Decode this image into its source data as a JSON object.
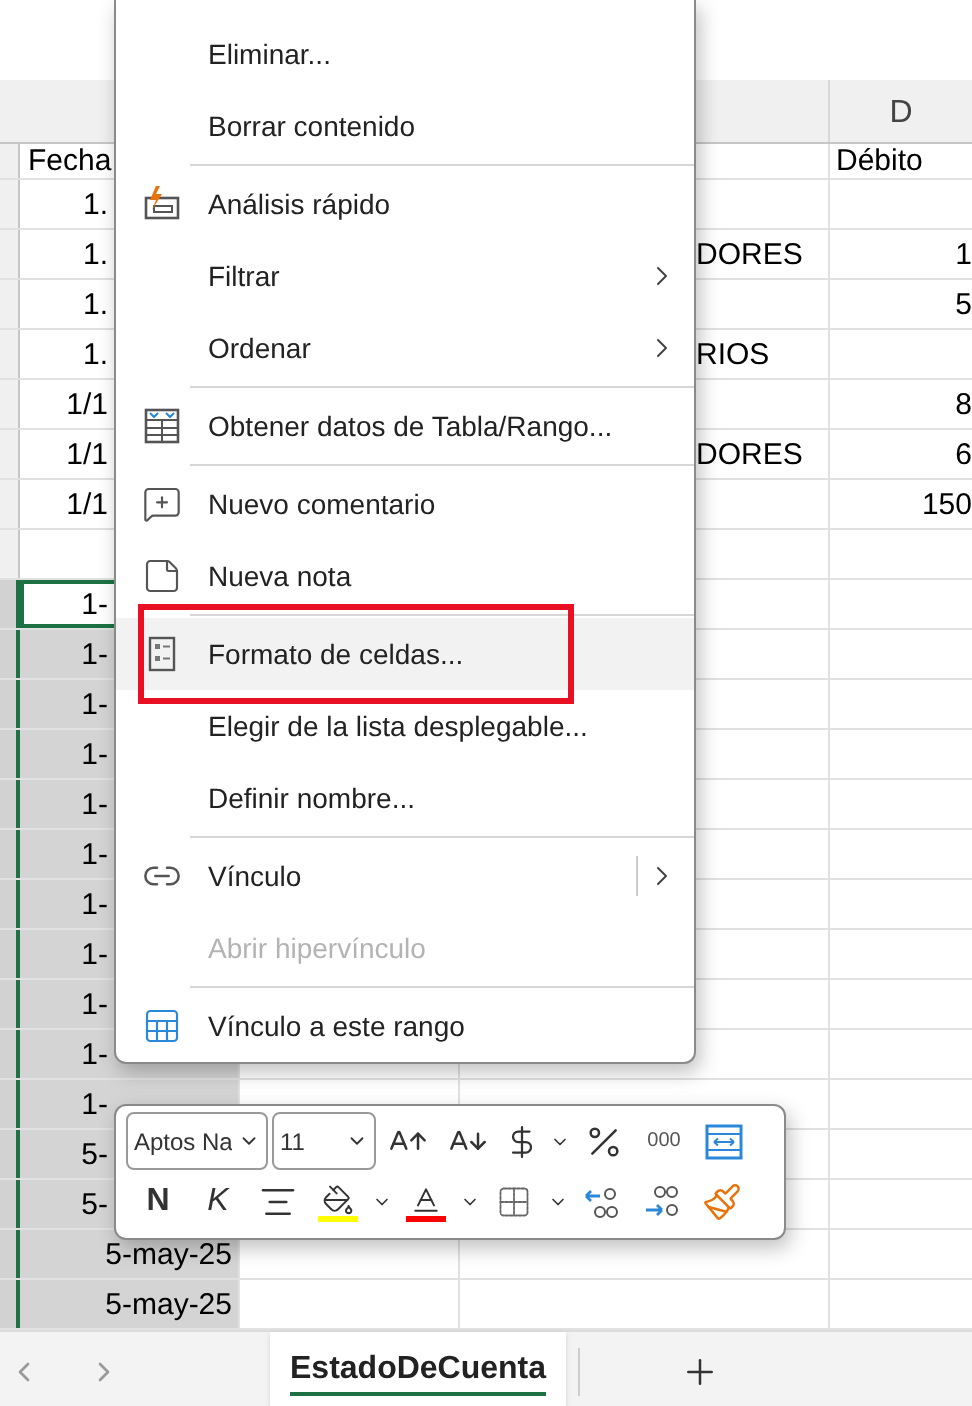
{
  "sheet": {
    "column_header": "D",
    "rows": [
      {
        "col_a": "Fecha",
        "col_c": "",
        "col_d": "Débito",
        "selected": false,
        "active": false
      },
      {
        "col_a": "1.",
        "col_c": "",
        "col_d": "",
        "selected": false,
        "active": false
      },
      {
        "col_a": "1.",
        "col_c": "DORES",
        "col_d": "1",
        "selected": false,
        "active": false
      },
      {
        "col_a": "1.",
        "col_c": "",
        "col_d": "5",
        "selected": false,
        "active": false
      },
      {
        "col_a": "1.",
        "col_c": "RIOS",
        "col_d": "",
        "selected": false,
        "active": false
      },
      {
        "col_a": "1/1",
        "col_c": "",
        "col_d": "8",
        "selected": false,
        "active": false
      },
      {
        "col_a": "1/1",
        "col_c": "DORES",
        "col_d": "6",
        "selected": false,
        "active": false
      },
      {
        "col_a": "1/1",
        "col_c": "",
        "col_d": "150",
        "selected": false,
        "active": false
      },
      {
        "col_a": "",
        "col_c": "",
        "col_d": "",
        "selected": false,
        "active": false
      },
      {
        "col_a": "1-",
        "col_c": "",
        "col_d": "",
        "selected": true,
        "active": true
      },
      {
        "col_a": "1-",
        "col_c": "",
        "col_d": "",
        "selected": true,
        "active": false
      },
      {
        "col_a": "1-",
        "col_c": "",
        "col_d": "",
        "selected": true,
        "active": false
      },
      {
        "col_a": "1-",
        "col_c": "",
        "col_d": "",
        "selected": true,
        "active": false
      },
      {
        "col_a": "1-",
        "col_c": "",
        "col_d": "",
        "selected": true,
        "active": false
      },
      {
        "col_a": "1-",
        "col_c": "",
        "col_d": "",
        "selected": true,
        "active": false
      },
      {
        "col_a": "1-",
        "col_c": "",
        "col_d": "",
        "selected": true,
        "active": false
      },
      {
        "col_a": "1-",
        "col_c": "",
        "col_d": "",
        "selected": true,
        "active": false
      },
      {
        "col_a": "1-",
        "col_c": "",
        "col_d": "",
        "selected": true,
        "active": false
      },
      {
        "col_a": "1-",
        "col_c": "",
        "col_d": "",
        "selected": true,
        "active": false
      },
      {
        "col_a": "1-",
        "col_c": "",
        "col_d": "",
        "selected": true,
        "active": false
      },
      {
        "col_a": "5-",
        "col_c": "",
        "col_d": "",
        "selected": true,
        "active": false
      },
      {
        "col_a": "5-",
        "col_c": "",
        "col_d": "",
        "selected": true,
        "active": false
      },
      {
        "col_a": "5-may-25",
        "col_c": "",
        "col_d": "",
        "selected": true,
        "active": false
      },
      {
        "col_a": "5-may-25",
        "col_c": "",
        "col_d": "",
        "selected": true,
        "active": false
      }
    ]
  },
  "context_menu": {
    "sections": [
      {
        "items": [
          {
            "label": "Eliminar...",
            "kind": "plain",
            "submenu": false,
            "split": false,
            "disabled": false,
            "hovered": false
          },
          {
            "label": "Borrar contenido",
            "kind": "plain",
            "submenu": false,
            "split": false,
            "disabled": false,
            "hovered": false
          }
        ]
      },
      {
        "items": [
          {
            "label": "Análisis rápido",
            "kind": "quick-analysis",
            "submenu": false,
            "split": false,
            "disabled": false,
            "hovered": false
          },
          {
            "label": "Filtrar",
            "kind": "plain",
            "submenu": true,
            "split": false,
            "disabled": false,
            "hovered": false
          },
          {
            "label": "Ordenar",
            "kind": "plain",
            "submenu": true,
            "split": false,
            "disabled": false,
            "hovered": false
          }
        ]
      },
      {
        "items": [
          {
            "label": "Obtener datos de Tabla/Rango...",
            "kind": "table-data",
            "submenu": false,
            "split": false,
            "disabled": false,
            "hovered": false
          }
        ]
      },
      {
        "items": [
          {
            "label": "Nuevo comentario",
            "kind": "comment",
            "submenu": false,
            "split": false,
            "disabled": false,
            "hovered": false
          },
          {
            "label": "Nueva nota",
            "kind": "note",
            "submenu": false,
            "split": false,
            "disabled": false,
            "hovered": false
          }
        ]
      },
      {
        "items": [
          {
            "label": "Formato de celdas...",
            "kind": "format",
            "submenu": false,
            "split": false,
            "disabled": false,
            "hovered": true
          },
          {
            "label": "Elegir de la lista desplegable...",
            "kind": "plain",
            "submenu": false,
            "split": false,
            "disabled": false,
            "hovered": false
          },
          {
            "label": "Definir nombre...",
            "kind": "plain",
            "submenu": false,
            "split": false,
            "disabled": false,
            "hovered": false
          }
        ]
      },
      {
        "items": [
          {
            "label": "Vínculo",
            "kind": "link",
            "submenu": true,
            "split": true,
            "disabled": false,
            "hovered": false
          },
          {
            "label": "Abrir hipervínculo",
            "kind": "plain",
            "submenu": false,
            "split": false,
            "disabled": true,
            "hovered": false
          }
        ]
      },
      {
        "items": [
          {
            "label": "Vínculo a este rango",
            "kind": "range-link",
            "submenu": false,
            "split": false,
            "disabled": false,
            "hovered": false
          }
        ]
      }
    ]
  },
  "mini_toolbar": {
    "font": "Aptos Na",
    "size": "11",
    "bold": "N",
    "italic": "K",
    "thousands": "000"
  },
  "sheet_tabs": [
    {
      "label": "EstadoDeCuenta",
      "selected": true
    }
  ]
}
